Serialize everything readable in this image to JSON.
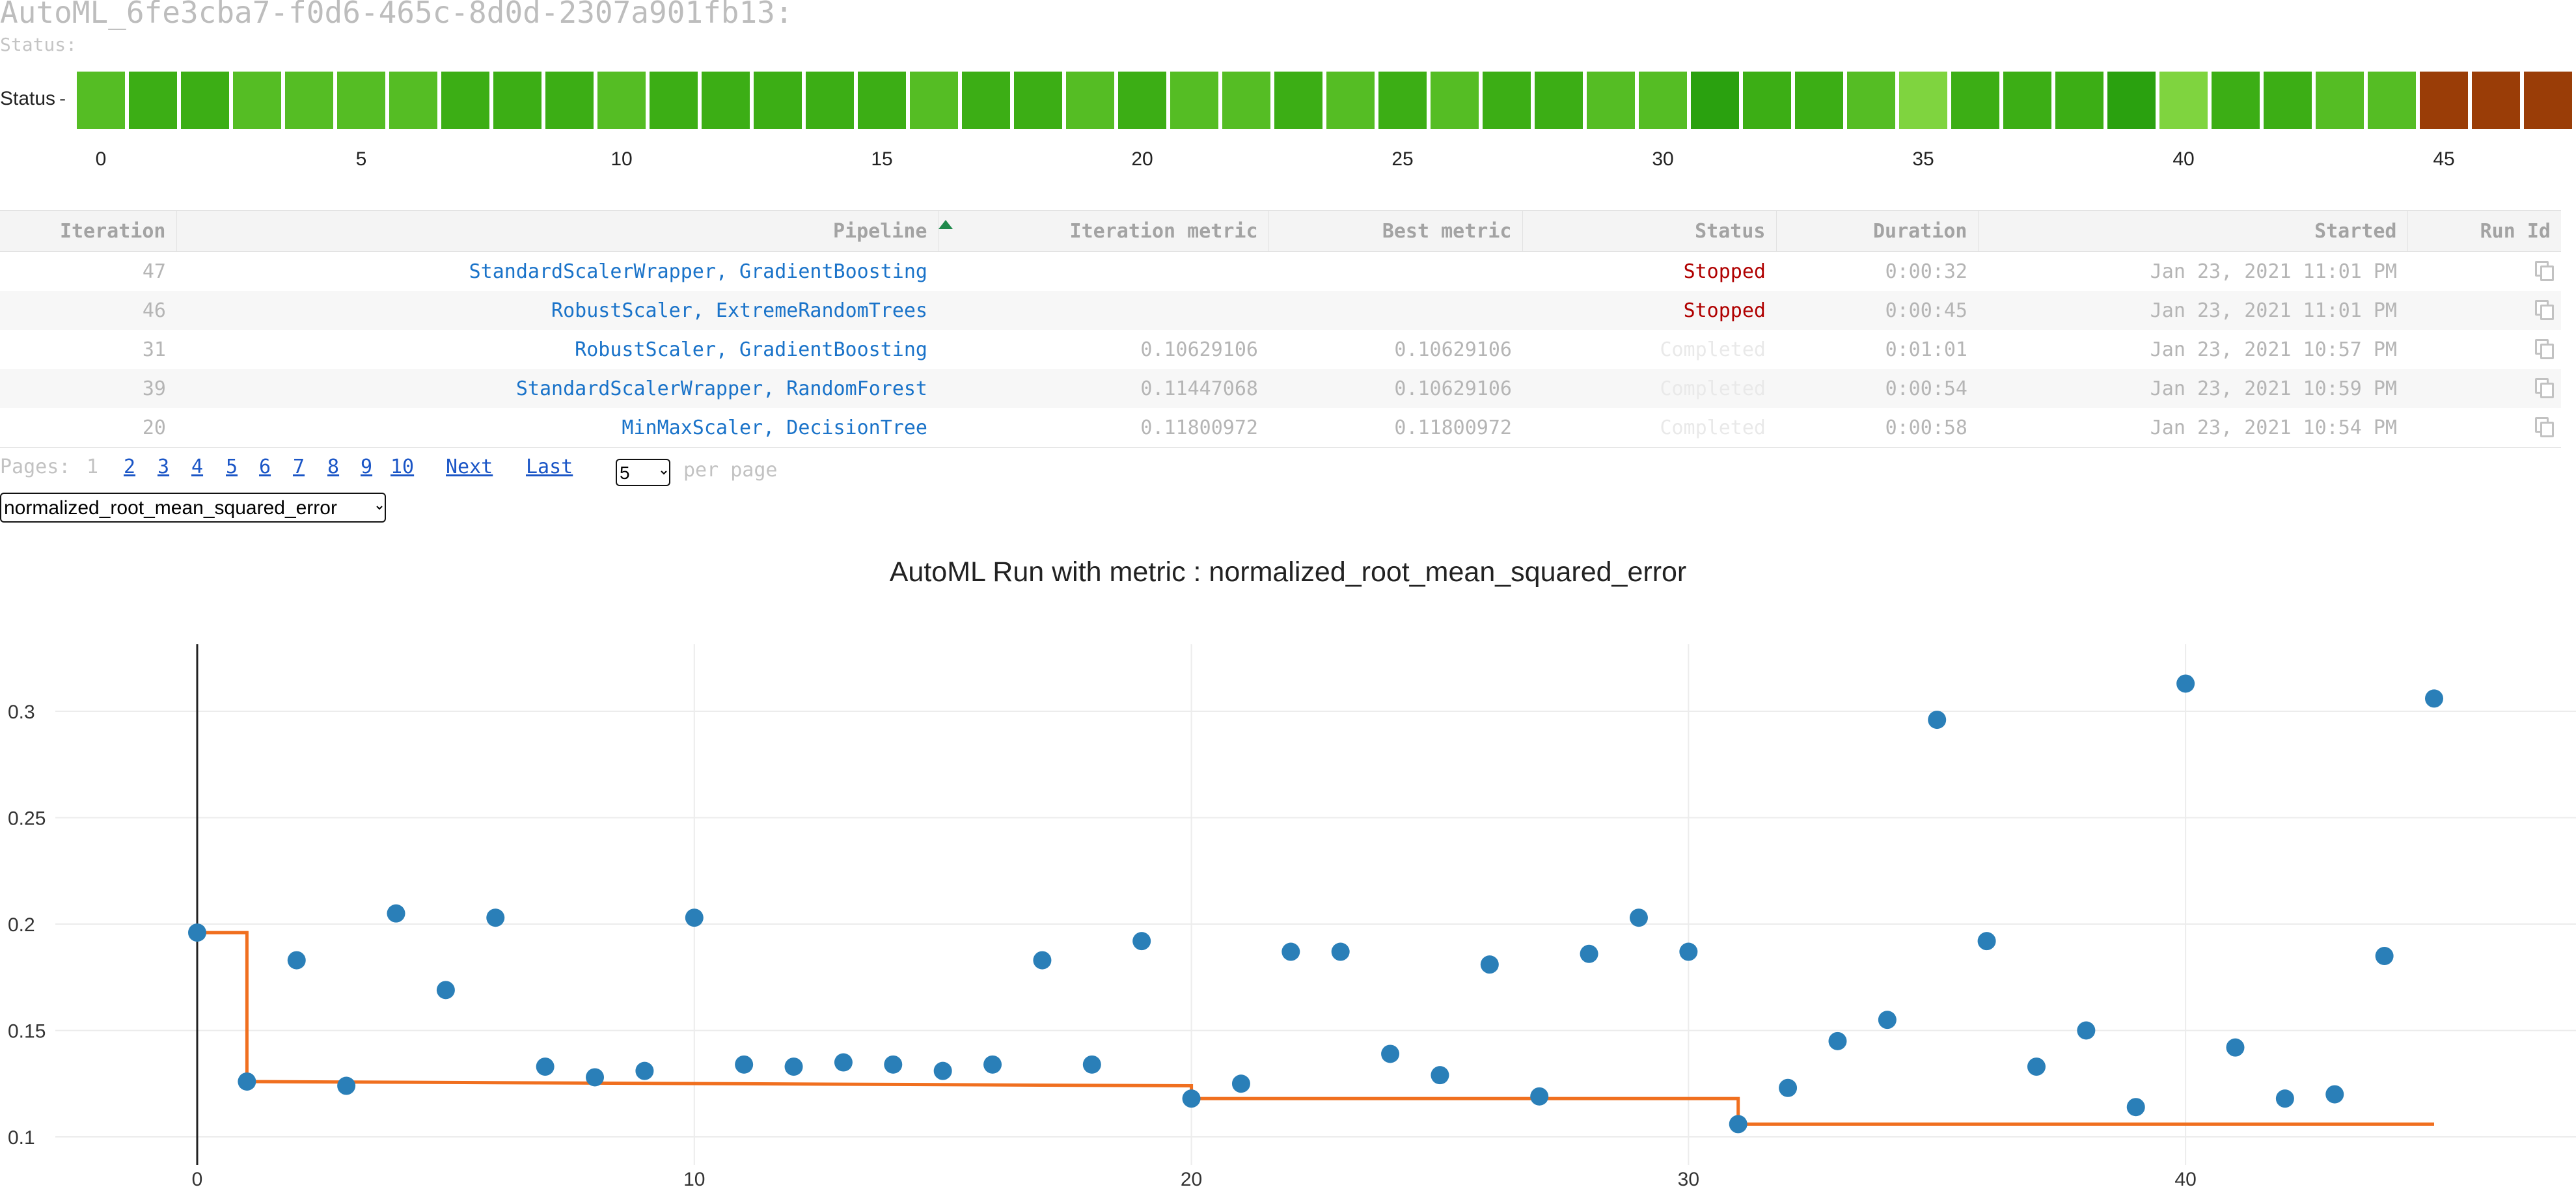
{
  "run": {
    "title": "AutoML_6fe3cba7-f0d6-465c-8d0d-2307a901fb13:",
    "status_caption": "Status:"
  },
  "status_strip": {
    "label": "Status",
    "tick_mark": "-",
    "colors": {
      "completed_dark": "#2aa10f",
      "completed_mid": "#3cae15",
      "completed_light": "#55bd24",
      "completed_pale": "#7fd43f",
      "stopped": "#9a3d07"
    },
    "cells": [
      "completed_light",
      "completed_mid",
      "completed_mid",
      "completed_light",
      "completed_light",
      "completed_light",
      "completed_light",
      "completed_mid",
      "completed_mid",
      "completed_mid",
      "completed_light",
      "completed_mid",
      "completed_mid",
      "completed_mid",
      "completed_mid",
      "completed_mid",
      "completed_light",
      "completed_mid",
      "completed_mid",
      "completed_light",
      "completed_mid",
      "completed_light",
      "completed_light",
      "completed_mid",
      "completed_light",
      "completed_mid",
      "completed_light",
      "completed_mid",
      "completed_mid",
      "completed_light",
      "completed_light",
      "completed_dark",
      "completed_mid",
      "completed_mid",
      "completed_light",
      "completed_pale",
      "completed_mid",
      "completed_mid",
      "completed_mid",
      "completed_dark",
      "completed_pale",
      "completed_mid",
      "completed_mid",
      "completed_light",
      "completed_light",
      "stopped",
      "stopped",
      "stopped"
    ],
    "ticks": [
      "0",
      "5",
      "10",
      "15",
      "20",
      "25",
      "30",
      "35",
      "40",
      "45"
    ]
  },
  "table": {
    "headers": {
      "iteration": "Iteration",
      "pipeline": "Pipeline",
      "iteration_metric": "Iteration metric",
      "best_metric": "Best metric",
      "status": "Status",
      "duration": "Duration",
      "started": "Started",
      "run_id": "Run Id"
    },
    "rows": [
      {
        "iteration": "47",
        "pipeline": "StandardScalerWrapper, GradientBoosting",
        "iteration_metric": "",
        "best_metric": "",
        "status": "Stopped",
        "duration": "0:00:32",
        "started": "Jan 23, 2021 11:01 PM"
      },
      {
        "iteration": "46",
        "pipeline": "RobustScaler, ExtremeRandomTrees",
        "iteration_metric": "",
        "best_metric": "",
        "status": "Stopped",
        "duration": "0:00:45",
        "started": "Jan 23, 2021 11:01 PM"
      },
      {
        "iteration": "31",
        "pipeline": "RobustScaler, GradientBoosting",
        "iteration_metric": "0.10629106",
        "best_metric": "0.10629106",
        "status": "Completed",
        "duration": "0:01:01",
        "started": "Jan 23, 2021 10:57 PM"
      },
      {
        "iteration": "39",
        "pipeline": "StandardScalerWrapper, RandomForest",
        "iteration_metric": "0.11447068",
        "best_metric": "0.10629106",
        "status": "Completed",
        "duration": "0:00:54",
        "started": "Jan 23, 2021 10:59 PM"
      },
      {
        "iteration": "20",
        "pipeline": "MinMaxScaler, DecisionTree",
        "iteration_metric": "0.11800972",
        "best_metric": "0.11800972",
        "status": "Completed",
        "duration": "0:00:58",
        "started": "Jan 23, 2021 10:54 PM"
      }
    ]
  },
  "pagination": {
    "label": "Pages:",
    "current": "1",
    "pages": [
      "2",
      "3",
      "4",
      "5",
      "6",
      "7",
      "8",
      "9",
      "10"
    ],
    "next": "Next",
    "last": "Last",
    "per_page_value": "5",
    "per_page_label": "per page"
  },
  "metric_selector": {
    "selected": "normalized_root_mean_squared_error"
  },
  "chart": {
    "title": "AutoML Run with metric : normalized_root_mean_squared_error"
  },
  "chart_data": {
    "type": "scatter",
    "title": "AutoML Run with metric : normalized_root_mean_squared_error",
    "xlabel": "",
    "ylabel": "",
    "xlim": [
      -4,
      48
    ],
    "ylim": [
      0.095,
      0.335
    ],
    "x_ticks": [
      0,
      10,
      20,
      30,
      40
    ],
    "y_ticks": [
      0.1,
      0.15,
      0.2,
      0.25,
      0.3
    ],
    "grid": true,
    "point_color": "#2a7fb8",
    "line_color": "#f06f1f",
    "series": [
      {
        "mode": "markers",
        "x": [
          0,
          1,
          2,
          3,
          4,
          5,
          6,
          7,
          8,
          9,
          10,
          11,
          12,
          13,
          14,
          15,
          16,
          17,
          18,
          19,
          20,
          21,
          22,
          23,
          24,
          25,
          26,
          27,
          28,
          29,
          30,
          31,
          32,
          33,
          34,
          35,
          36,
          37,
          38,
          39,
          40,
          41,
          42,
          43,
          44,
          45
        ],
        "y": [
          0.196,
          0.126,
          0.183,
          0.124,
          0.205,
          0.169,
          0.203,
          0.133,
          0.128,
          0.131,
          0.203,
          0.134,
          0.133,
          0.135,
          0.134,
          0.131,
          0.134,
          0.183,
          0.134,
          0.192,
          0.118,
          0.125,
          0.187,
          0.187,
          0.139,
          0.129,
          0.181,
          0.119,
          0.186,
          0.203,
          0.187,
          0.106,
          0.123,
          0.145,
          0.155,
          0.296,
          0.192,
          0.133,
          0.15,
          0.114,
          0.313,
          0.142,
          0.118,
          0.12,
          0.185,
          0.306
        ]
      },
      {
        "mode": "step-line",
        "x": [
          0,
          1,
          1,
          20,
          20,
          31,
          31,
          45
        ],
        "y": [
          0.196,
          0.196,
          0.126,
          0.124,
          0.118,
          0.118,
          0.106,
          0.106
        ]
      }
    ]
  }
}
